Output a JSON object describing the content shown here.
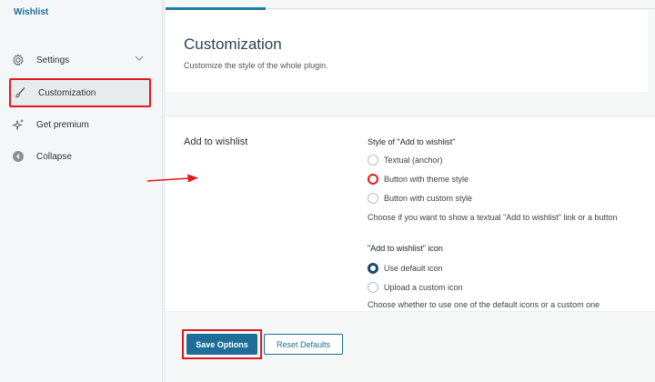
{
  "sidebar": {
    "brand": "Wishlist",
    "items": [
      {
        "label": "Settings",
        "icon": "gear-icon"
      },
      {
        "label": "Customization",
        "icon": "brush-icon"
      },
      {
        "label": "Get premium",
        "icon": "sparkle-icon"
      },
      {
        "label": "Collapse",
        "icon": "collapse-icon"
      }
    ]
  },
  "header": {
    "title": "Customization",
    "subtitle": "Customize the style of the whole plugin."
  },
  "section": {
    "label": "Add to wishlist",
    "style": {
      "title": "Style of \"Add to wishlist\"",
      "options": [
        "Textual (anchor)",
        "Button with theme style",
        "Button with custom style"
      ],
      "selected": "Button with theme style",
      "help": "Choose if you want to show a textual \"Add to wishlist\" link or a button"
    },
    "icon": {
      "title": "\"Add to wishlist\" icon",
      "options": [
        "Use default icon",
        "Upload a custom icon"
      ],
      "selected": "Use default icon",
      "help": "Choose whether to use one of the default icons or a custom one"
    }
  },
  "footer": {
    "save_label": "Save Options",
    "reset_label": "Reset Defaults"
  },
  "colors": {
    "accent": "#1d6f99",
    "highlight": "#e0191f"
  }
}
